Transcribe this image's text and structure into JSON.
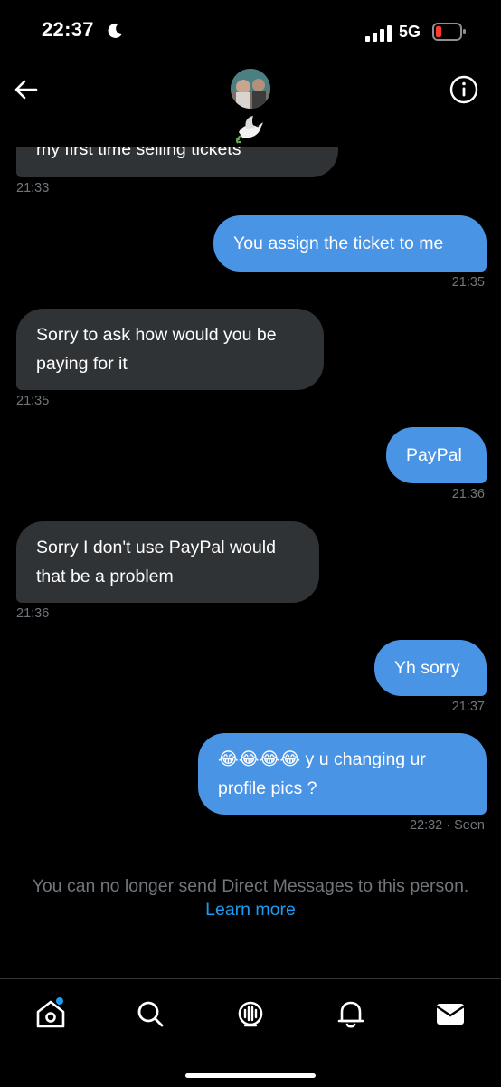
{
  "status_bar": {
    "time": "22:37",
    "network": "5G"
  },
  "conversation": {
    "partial_message": "my first time selling tickets",
    "partial_time": "21:33",
    "messages": [
      {
        "direction": "out",
        "text": "You assign the ticket to me",
        "time": "21:35"
      },
      {
        "direction": "in",
        "text": "Sorry to ask how would you be\npaying for it",
        "time": "21:35"
      },
      {
        "direction": "out",
        "text": "PayPal",
        "time": "21:36"
      },
      {
        "direction": "in",
        "text": "Sorry I don't use PayPal would\nthat be a problem",
        "time": "21:36"
      },
      {
        "direction": "out",
        "text": "Yh sorry",
        "time": "21:37"
      },
      {
        "direction": "out",
        "text": "😂😂😂😂 y u changing ur\nprofile pics ?",
        "time": "22:32 · Seen"
      }
    ]
  },
  "notice": {
    "text": "You can no longer send Direct Messages to this person.",
    "link": "Learn more"
  },
  "icons": {
    "back": "arrow-left-icon",
    "info": "info-icon",
    "header_emoji": "dove-icon",
    "tabs": [
      "home-icon",
      "search-icon",
      "spaces-icon",
      "notifications-icon",
      "messages-icon"
    ]
  },
  "colors": {
    "background": "#000000",
    "incoming_bubble": "#2f3336",
    "outgoing_bubble": "#4a94e6",
    "link": "#1d9bf0",
    "muted_text": "#71767b"
  }
}
